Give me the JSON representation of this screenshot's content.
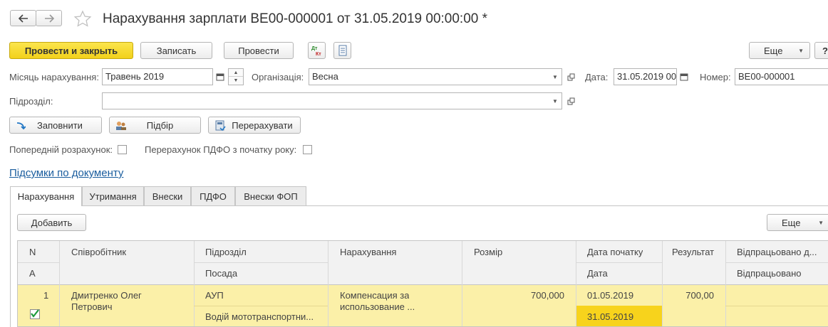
{
  "header": {
    "back_icon": "arrow-left-icon",
    "forward_icon": "arrow-right-icon",
    "favorite_icon": "star-icon",
    "title": "Нарахування зарплати ВЕ00-000001 от 31.05.2019 00:00:00 *"
  },
  "toolbar": {
    "post_close": "Провести и закрыть",
    "save": "Записать",
    "post": "Провести",
    "more": "Еще",
    "help": "?"
  },
  "form": {
    "month_label": "Місяць нарахування:",
    "month_value": "Травень 2019",
    "org_label": "Організація:",
    "org_value": "Весна",
    "date_label": "Дата:",
    "date_value": "31.05.2019 00",
    "number_label": "Номер:",
    "number_value": "ВЕ00-000001",
    "dept_label": "Підрозділ:",
    "dept_value": ""
  },
  "actions": {
    "fill": "Заповнити",
    "select": "Підбір",
    "recalc": "Перерахувати"
  },
  "options": {
    "prelim_label": "Попередній розрахунок:",
    "pdfo_label": "Перерахунок ПДФО з початку року:"
  },
  "summary_link": "Підсумки по документу",
  "tabs": [
    "Нарахування",
    "Утримання",
    "Внески",
    "ПДФО",
    "Внески ФОП"
  ],
  "table_toolbar": {
    "add": "Добавить",
    "more": "Еще"
  },
  "table": {
    "headers_top": [
      "N",
      "Співробітник",
      "Підрозділ",
      "Нарахування",
      "Розмір",
      "Дата початку",
      "Результат",
      "Відпрацьовано д..."
    ],
    "headers_bottom": [
      "A",
      "",
      "Посада",
      "",
      "",
      "Дата",
      "",
      "Відпрацьовано"
    ],
    "rows": [
      {
        "n": "1",
        "employee": "Дмитренко Олег Петрович",
        "employee_line1": "Дмитренко Олег",
        "employee_line2": "Петрович",
        "department": "АУП",
        "position": "Водій мототранспортни...",
        "accrual_line1": "Компенсация за",
        "accrual_line2": "использование ...",
        "amount": "700,000",
        "start_date": "01.05.2019",
        "end_date": "31.05.2019",
        "result": "700,00",
        "worked_days": "",
        "worked": ""
      }
    ]
  },
  "colors": {
    "primary_button": "#f2d11b",
    "row_highlight": "#fbf0a8",
    "selected_cell": "#f7d31c",
    "link": "#1a5d9e"
  }
}
